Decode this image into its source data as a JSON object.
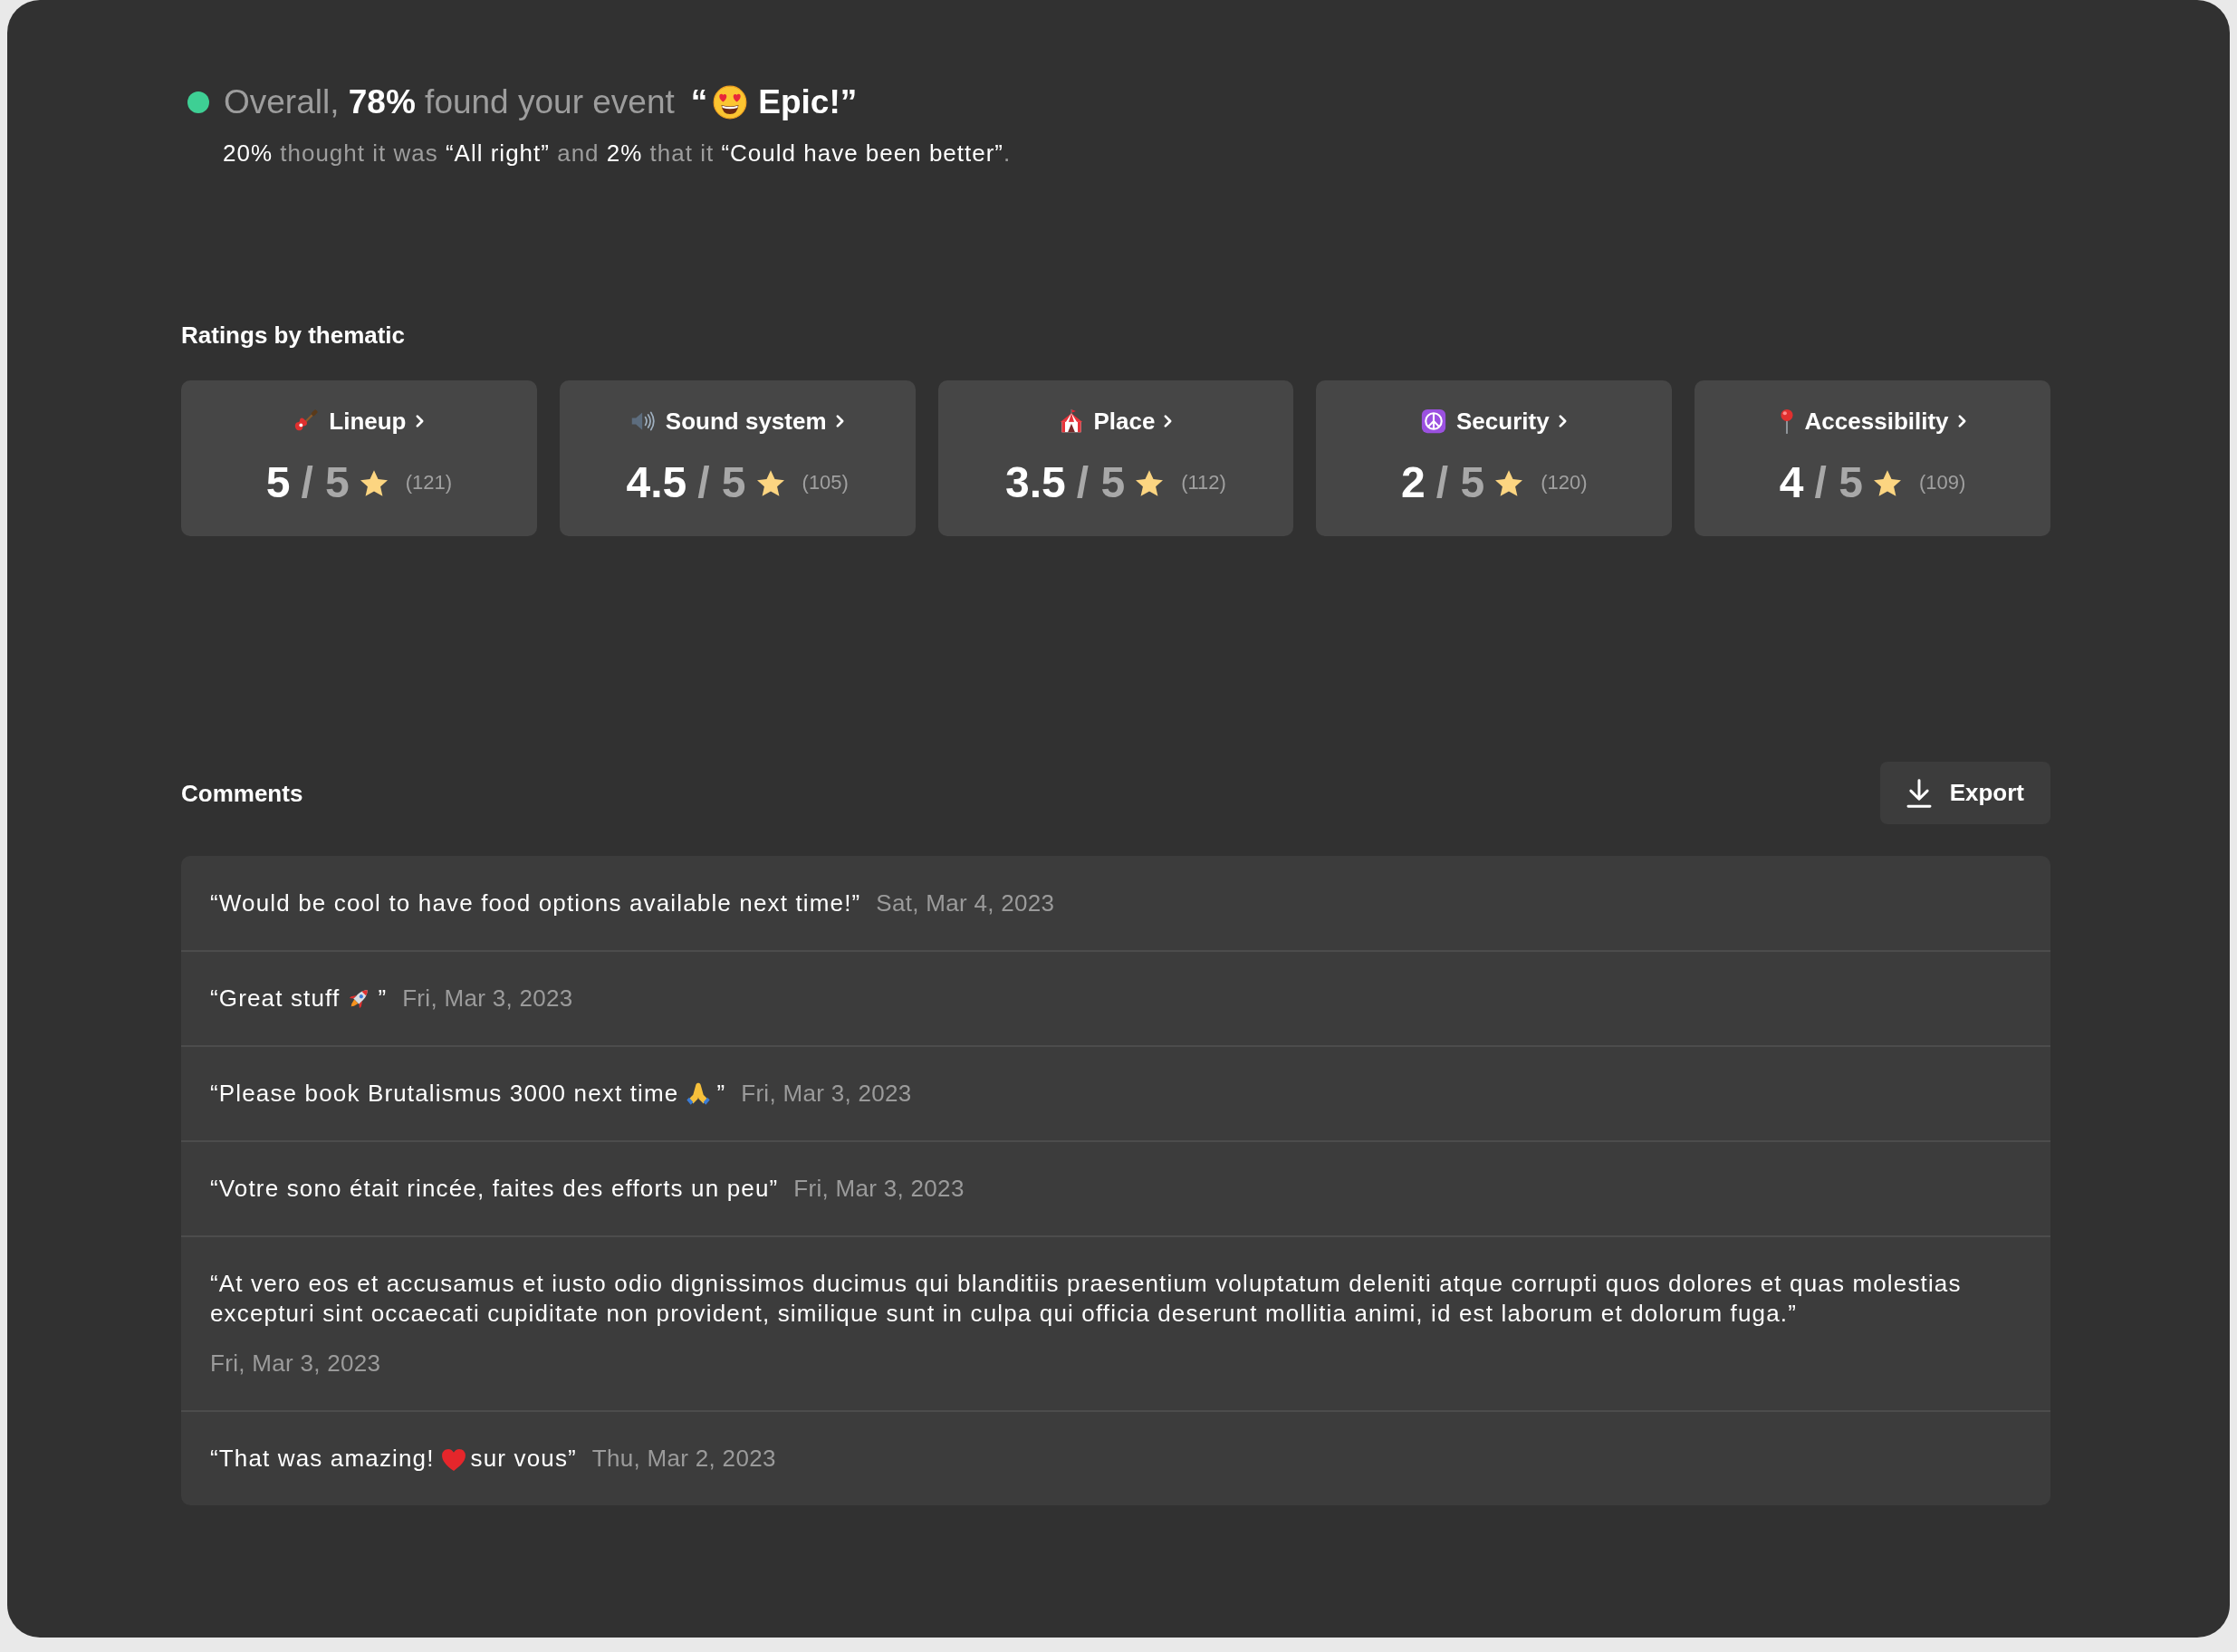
{
  "summary": {
    "headline": "Overall, **78%** found your event",
    "verdict_open": "“",
    "verdict": "Epic!”",
    "details": "**20%** thought it was **“All right”** and **2%** that it **“Could have been better”**."
  },
  "ratings": {
    "title": "Ratings by thematic",
    "items": [
      {
        "kind": "guitar",
        "label": "Lineup",
        "score": "5",
        "out_of": "/ 5",
        "count": "(121)"
      },
      {
        "kind": "speaker",
        "label": "Sound system",
        "score": "4.5",
        "out_of": "/ 5",
        "count": "(105)"
      },
      {
        "kind": "tent",
        "label": "Place",
        "score": "3.5",
        "out_of": "/ 5",
        "count": "(112)"
      },
      {
        "kind": "peace",
        "label": "Security",
        "score": "2",
        "out_of": "/ 5",
        "count": "(120)"
      },
      {
        "kind": "pin",
        "label": "Accessibility",
        "score": "4",
        "out_of": "/ 5",
        "count": "(109)"
      }
    ]
  },
  "comments": {
    "title": "Comments",
    "export_label": "Export",
    "items": [
      {
        "parts": [
          {
            "kind": "text",
            "text": "“Would be cool to have food options available next time!”"
          }
        ],
        "date": "Sat, Mar 4, 2023"
      },
      {
        "parts": [
          {
            "kind": "text",
            "text": "“Great stuff"
          },
          {
            "kind": "rocket"
          },
          {
            "kind": "text",
            "text": "”"
          }
        ],
        "date": "Fri, Mar 3, 2023"
      },
      {
        "parts": [
          {
            "kind": "text",
            "text": "“Please book Brutalismus 3000 next time"
          },
          {
            "kind": "hands"
          },
          {
            "kind": "text",
            "text": "”"
          }
        ],
        "date": "Fri, Mar 3, 2023"
      },
      {
        "parts": [
          {
            "kind": "text",
            "text": "“Votre sono était rincée, faites des efforts un peu”"
          }
        ],
        "date": "Fri, Mar 3, 2023"
      },
      {
        "parts": [
          {
            "kind": "text",
            "text": "“At vero eos et accusamus et iusto odio dignissimos ducimus qui blanditiis praesentium voluptatum deleniti atque corrupti quos dolores et quas molestias excepturi sint occaecati cupiditate non provident, similique sunt in culpa qui officia deserunt mollitia animi, id est laborum et dolorum fuga.”"
          }
        ],
        "date": "Fri, Mar 3, 2023"
      },
      {
        "parts": [
          {
            "kind": "text",
            "text": "“That was amazing!"
          },
          {
            "kind": "heart"
          },
          {
            "kind": "text",
            "text": "sur vous”"
          }
        ],
        "date": "Thu, Mar 2, 2023"
      }
    ]
  }
}
